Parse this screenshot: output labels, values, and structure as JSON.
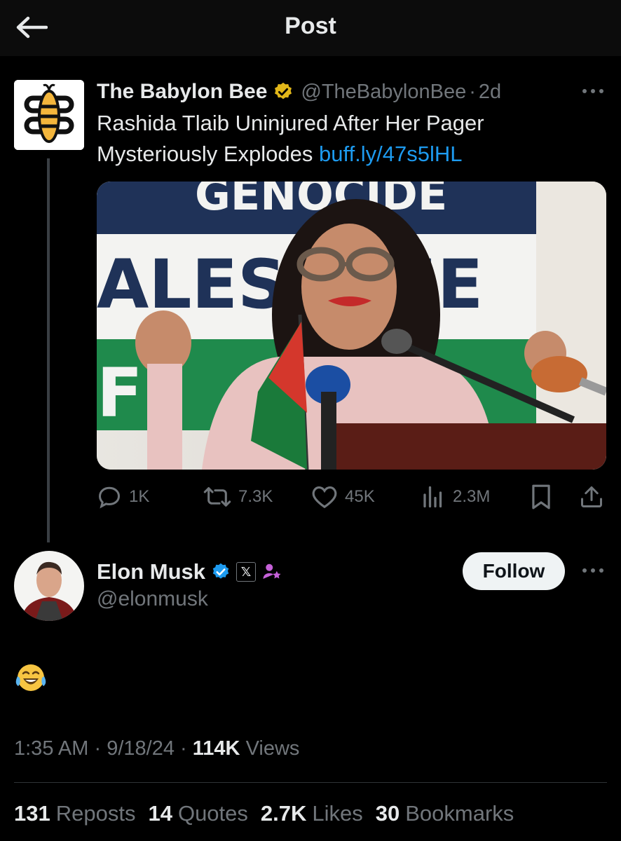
{
  "header": {
    "title": "Post"
  },
  "parent_post": {
    "author_name": "The Babylon Bee",
    "handle": "@TheBabylonBee",
    "separator": "·",
    "age": "2d",
    "text": "Rashida Tlaib Uninjured After Her Pager Mysteriously Explodes",
    "link": "buff.ly/47s5lHL",
    "media": {
      "banner_lines": [
        "GENOCIDE",
        "ALES",
        "IE",
        "F"
      ]
    },
    "actions": {
      "replies": "1K",
      "reposts": "7.3K",
      "likes": "45K",
      "views": "2.3M"
    }
  },
  "reply": {
    "author_name": "Elon Musk",
    "badge_x": "𝕏",
    "handle": "@elonmusk",
    "follow_label": "Follow",
    "body_emoji": "😂",
    "time": "1:35 AM",
    "sep1": "·",
    "date": "9/18/24",
    "sep2": "·",
    "views_count": "114K",
    "views_label": "Views"
  },
  "stats": {
    "reposts_count": "131",
    "reposts_label": "Reposts",
    "quotes_count": "14",
    "quotes_label": "Quotes",
    "likes_count": "2.7K",
    "likes_label": "Likes",
    "bookmarks_count": "30",
    "bookmarks_label": "Bookmarks"
  },
  "colors": {
    "background": "#000000",
    "text": "#e7e9ea",
    "muted": "#71767b",
    "link": "#1d9bf0",
    "gold_verified": "#e2b719",
    "blue_verified": "#1d9bf0",
    "follow_bg": "#eff3f4"
  },
  "icons": [
    "back-arrow-icon",
    "gold-verified-icon",
    "blue-verified-icon",
    "x-logo-icon",
    "subscriber-star-icon",
    "more-icon",
    "reply-icon",
    "repost-icon",
    "like-icon",
    "views-icon",
    "bookmark-icon",
    "share-icon"
  ]
}
